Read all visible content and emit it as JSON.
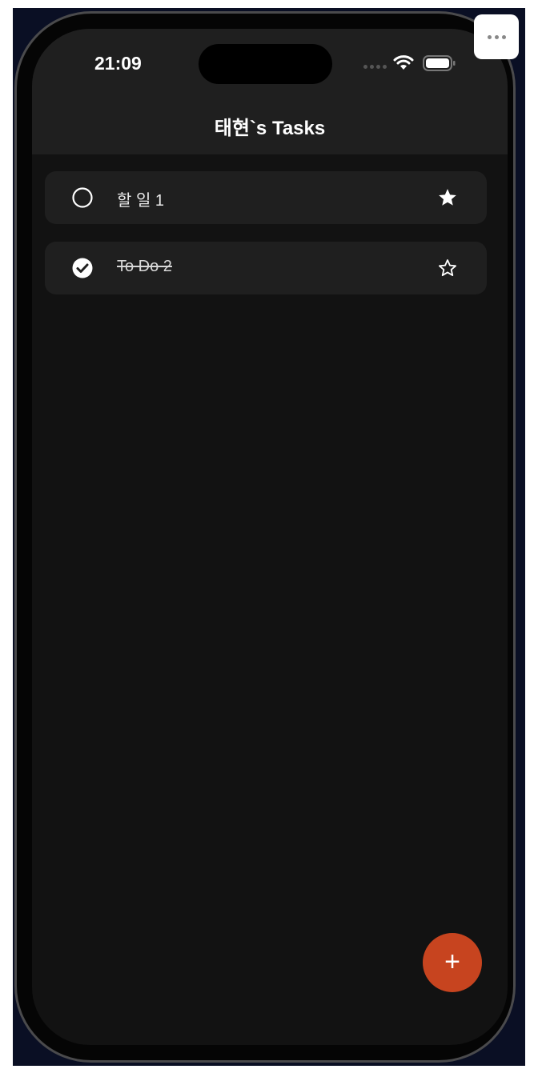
{
  "status_bar": {
    "time": "21:09"
  },
  "header": {
    "title": "태현`s Tasks"
  },
  "tasks": [
    {
      "label": "할 일 1",
      "done": false,
      "starred": true
    },
    {
      "label": "To Do 2",
      "done": true,
      "starred": false
    }
  ],
  "fab": {
    "label": "+",
    "icon": "plus-icon"
  },
  "colors": {
    "accent": "#c7441f",
    "card": "#1f1f1f",
    "background": "#121212"
  }
}
